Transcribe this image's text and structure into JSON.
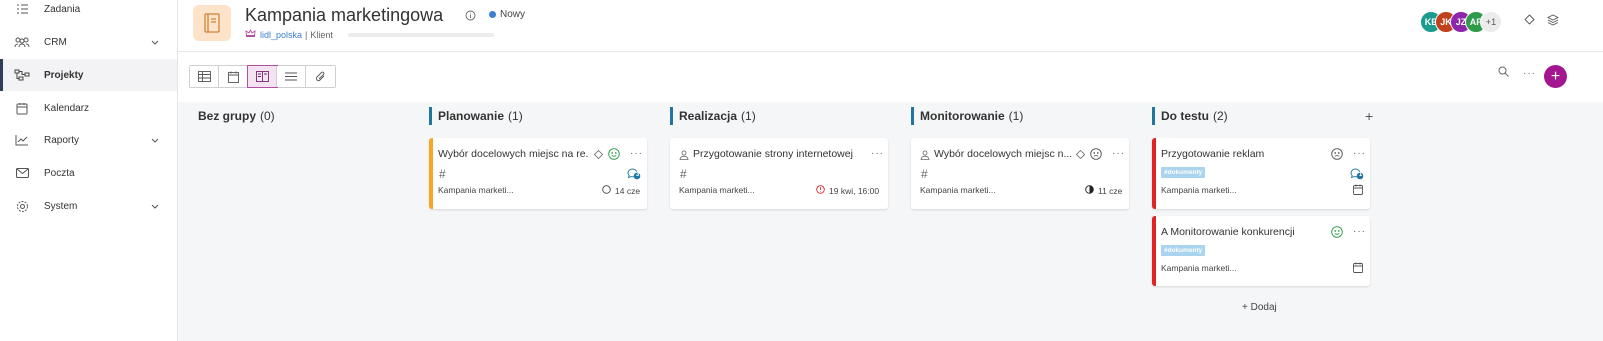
{
  "sidebar": {
    "items": [
      {
        "label": "Zadania",
        "icon": "list-check-icon",
        "chevron": false
      },
      {
        "label": "CRM",
        "icon": "people-icon",
        "chevron": true
      },
      {
        "label": "Projekty",
        "icon": "project-flow-icon",
        "chevron": false,
        "active": true
      },
      {
        "label": "Kalendarz",
        "icon": "calendar-icon",
        "chevron": false
      },
      {
        "label": "Raporty",
        "icon": "chart-icon",
        "chevron": true
      },
      {
        "label": "Poczta",
        "icon": "mail-icon",
        "chevron": false
      },
      {
        "label": "System",
        "icon": "gear-icon",
        "chevron": true
      }
    ]
  },
  "header": {
    "title": "Kampania marketingowa",
    "status": "Nowy",
    "status_color": "#3b7fd0",
    "owner": "lidl_polska",
    "separator": "|",
    "client_label": "Klient",
    "avatars": [
      {
        "initials": "KE",
        "color": "#1a9b8e"
      },
      {
        "initials": "JK",
        "color": "#c2411d"
      },
      {
        "initials": "JZ",
        "color": "#8e24aa"
      },
      {
        "initials": "AP",
        "color": "#2e9a4a"
      }
    ],
    "avatars_more": "+1"
  },
  "toolbar": {
    "views": [
      "table-view-icon",
      "calendar-view-icon",
      "board-view-icon",
      "list-view-icon",
      "attachment-view-icon"
    ],
    "active_view": 2,
    "add_label": "+"
  },
  "board": {
    "columns": [
      {
        "name": "Bez grupy",
        "count": "(0)",
        "accent": false
      },
      {
        "name": "Planowanie",
        "count": "(1)",
        "accent": true
      },
      {
        "name": "Realizacja",
        "count": "(1)",
        "accent": true
      },
      {
        "name": "Monitorowanie",
        "count": "(1)",
        "accent": true
      },
      {
        "name": "Do testu",
        "count": "(2)",
        "accent": true
      }
    ],
    "col_add_label": "+",
    "cards": {
      "planowanie": {
        "title": "Wybór docelowych miejsc na re...",
        "project": "Kampania marketi...",
        "due": "14 cze",
        "badge": "3",
        "border_color": "#f5a623"
      },
      "realizacja": {
        "title": "Przygotowanie strony internetowej",
        "project": "Kampania marketi...",
        "due": "19 kwi, 16:00"
      },
      "monitorowanie": {
        "title": "Wybór docelowych miejsc n...",
        "project": "Kampania marketi...",
        "due": "11 cze"
      },
      "test1": {
        "title": "Przygotowanie reklam",
        "tag": "#dokumenty",
        "project": "Kampania marketi...",
        "badge": "1",
        "border_color": "#e02424"
      },
      "test2": {
        "title": "A Monitorowanie konkurencji",
        "tag": "#dokumenty",
        "project": "Kampania marketi...",
        "border_color": "#e02424"
      }
    },
    "hash_symbol": "#",
    "add_card_label": "+ Dodaj"
  }
}
